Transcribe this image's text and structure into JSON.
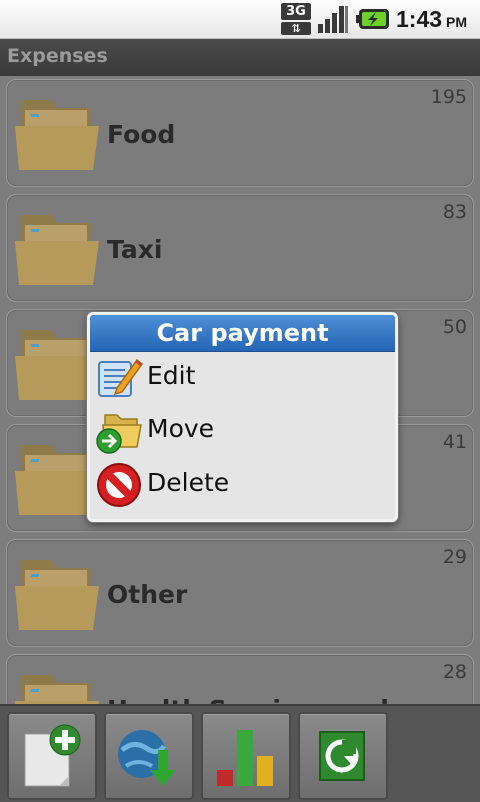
{
  "status_bar": {
    "network": "3G",
    "network_arrows": "⇅",
    "time": "1:43",
    "ampm": "PM",
    "signal_icon": "signal-icon",
    "battery_icon": "battery-charging-icon"
  },
  "title": "Expenses",
  "categories": [
    {
      "name": "Food",
      "count": "195"
    },
    {
      "name": "Taxi",
      "count": "83"
    },
    {
      "name": "",
      "count": "50"
    },
    {
      "name": "",
      "count": "41"
    },
    {
      "name": "Other",
      "count": "29"
    },
    {
      "name": "Health Services and",
      "count": "28"
    }
  ],
  "context_menu": {
    "title": "Car payment",
    "items": [
      {
        "label": "Edit",
        "icon": "edit-icon"
      },
      {
        "label": "Move",
        "icon": "move-folder-icon"
      },
      {
        "label": "Delete",
        "icon": "delete-icon"
      }
    ]
  },
  "toolbar": {
    "buttons": [
      {
        "icon": "add-document-icon"
      },
      {
        "icon": "globe-download-icon"
      },
      {
        "icon": "bar-chart-icon"
      },
      {
        "icon": "refresh-icon"
      }
    ]
  },
  "colors": {
    "dialog_header": "#2f76c4",
    "folder": "#d4b46a"
  }
}
